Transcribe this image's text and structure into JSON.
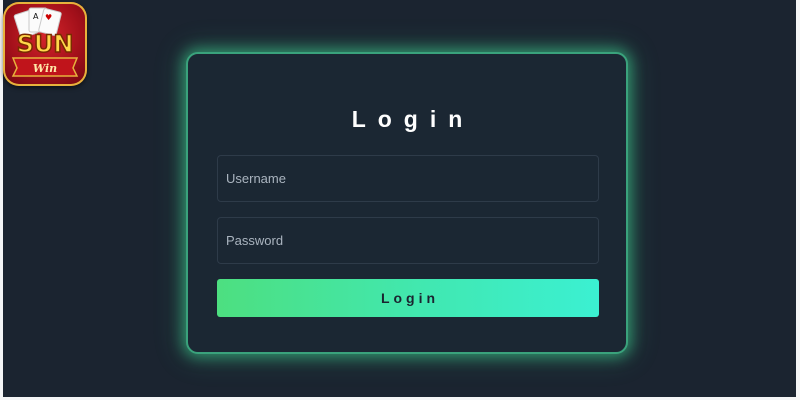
{
  "logo": {
    "text": "SUNWIN",
    "colors": {
      "background": "#b5151e",
      "border": "#e7b23c",
      "text": "#ffd84a"
    }
  },
  "login_form": {
    "title": "Login",
    "username_placeholder": "Username",
    "password_placeholder": "Password",
    "submit_label": "Login"
  },
  "colors": {
    "page_background": "#1b2430",
    "card_background": "#1b2733",
    "card_glow": "#40dc96",
    "button_gradient_start": "#4ddf80",
    "button_gradient_end": "#3bf0d2"
  }
}
